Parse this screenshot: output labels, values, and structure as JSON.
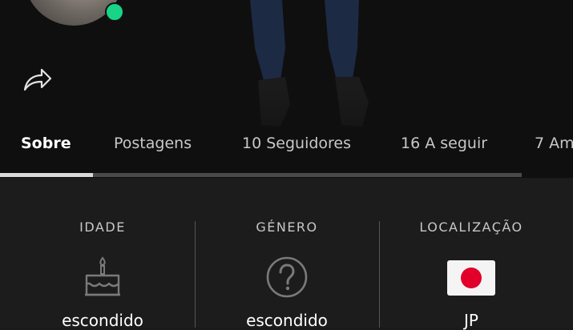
{
  "profile": {
    "online_status": "online",
    "status_color": "#18d487"
  },
  "actions": {
    "share_icon": "share-arrow-icon"
  },
  "tabs": [
    {
      "label": "Sobre",
      "active": true
    },
    {
      "label": "Postagens",
      "active": false
    },
    {
      "label": "10 Seguidores",
      "active": false
    },
    {
      "label": "16 A seguir",
      "active": false
    },
    {
      "label": "7 Am",
      "active": false
    }
  ],
  "info": {
    "age": {
      "label": "IDADE",
      "value": "escondido",
      "icon": "birthday-cake-icon"
    },
    "gender": {
      "label": "GÉNERO",
      "value": "escondido",
      "icon": "question-mark-icon"
    },
    "location": {
      "label": "LOCALIZAÇÃO",
      "value": "JP",
      "icon": "japan-flag-icon"
    }
  }
}
